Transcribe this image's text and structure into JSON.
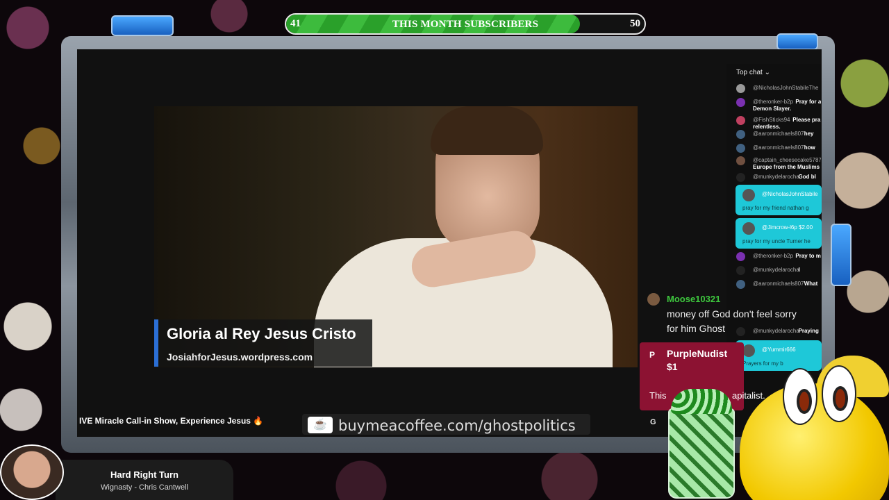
{
  "subscriber_goal": {
    "current": "41",
    "target": "50",
    "progress": 0.82,
    "label": "THIS MONTH SUBSCRIBERS"
  },
  "stream": {
    "lower_third_title": "Gloria al Rey Jesus Cristo",
    "lower_third_sub": "JosiahforJesus.wordpress.com",
    "ticker": "IVE Miracle Call-in Show, Experience Jesus 🔥",
    "coffee_link": "buymeacoffee.com/ghostpolitics",
    "letter": "G"
  },
  "chat": {
    "header": "Top chat ⌄",
    "rows": [
      {
        "user": "@NicholasJohnStabileThe",
        "msg": "",
        "cont": ""
      },
      {
        "user": "@theronker-b2p",
        "msg": "Pray for a",
        "cont": "Demon Slayer."
      },
      {
        "user": "@FishSticks94",
        "msg": "Please pra",
        "cont": "relentless."
      },
      {
        "user": "@aaronmichaels807",
        "msg": "hey",
        "cont": ""
      },
      {
        "user": "@aaronmichaels807",
        "msg": "how",
        "cont": ""
      },
      {
        "user": "@captain_cheesecake5787",
        "msg": "",
        "cont": "Europe from the Muslims C"
      },
      {
        "user": "@munkydelarocha",
        "msg": "God bl",
        "cont": ""
      },
      {
        "user": "@theronker-b2p",
        "msg": "Pray to m",
        "cont": ""
      },
      {
        "user": "@munkydelarocha",
        "msg": "I",
        "cont": ""
      },
      {
        "user": "@aaronmichaels807",
        "msg": "What",
        "cont": ""
      },
      {
        "user": "@munkydelarocha",
        "msg": "Praying",
        "cont": ""
      }
    ],
    "superchats": [
      {
        "user": "@NicholasJohnStabile",
        "msg": "pray for my friend nathan g",
        "color": "#1ec8d8"
      },
      {
        "user": "@Jimcrow-l6p  $2.00",
        "msg": "pray for my uncle Turner he",
        "color": "#1ec8d8"
      },
      {
        "user": "@Yummir666",
        "msg": "Prayers for my b",
        "color": "#1ec8d8"
      }
    ]
  },
  "overlay_chat": {
    "user1": "Moose10321",
    "msg1_line1": "money off God don't feel sorry",
    "msg1_line2": "for him Ghost",
    "user2_initial": "P",
    "user2": "PurpleNudist",
    "amount": "$1",
    "msg2_start": "This",
    "msg2_end": "apitalist."
  },
  "now_playing": {
    "title": "Hard Right Turn",
    "artist": "Wignasty - Chris Cantwell"
  },
  "colors": {
    "progress_green": "#2aa02a",
    "superchat_cyan": "#1ec8d8",
    "donation_red": "#8c1232",
    "username_green": "#3ec83e"
  }
}
